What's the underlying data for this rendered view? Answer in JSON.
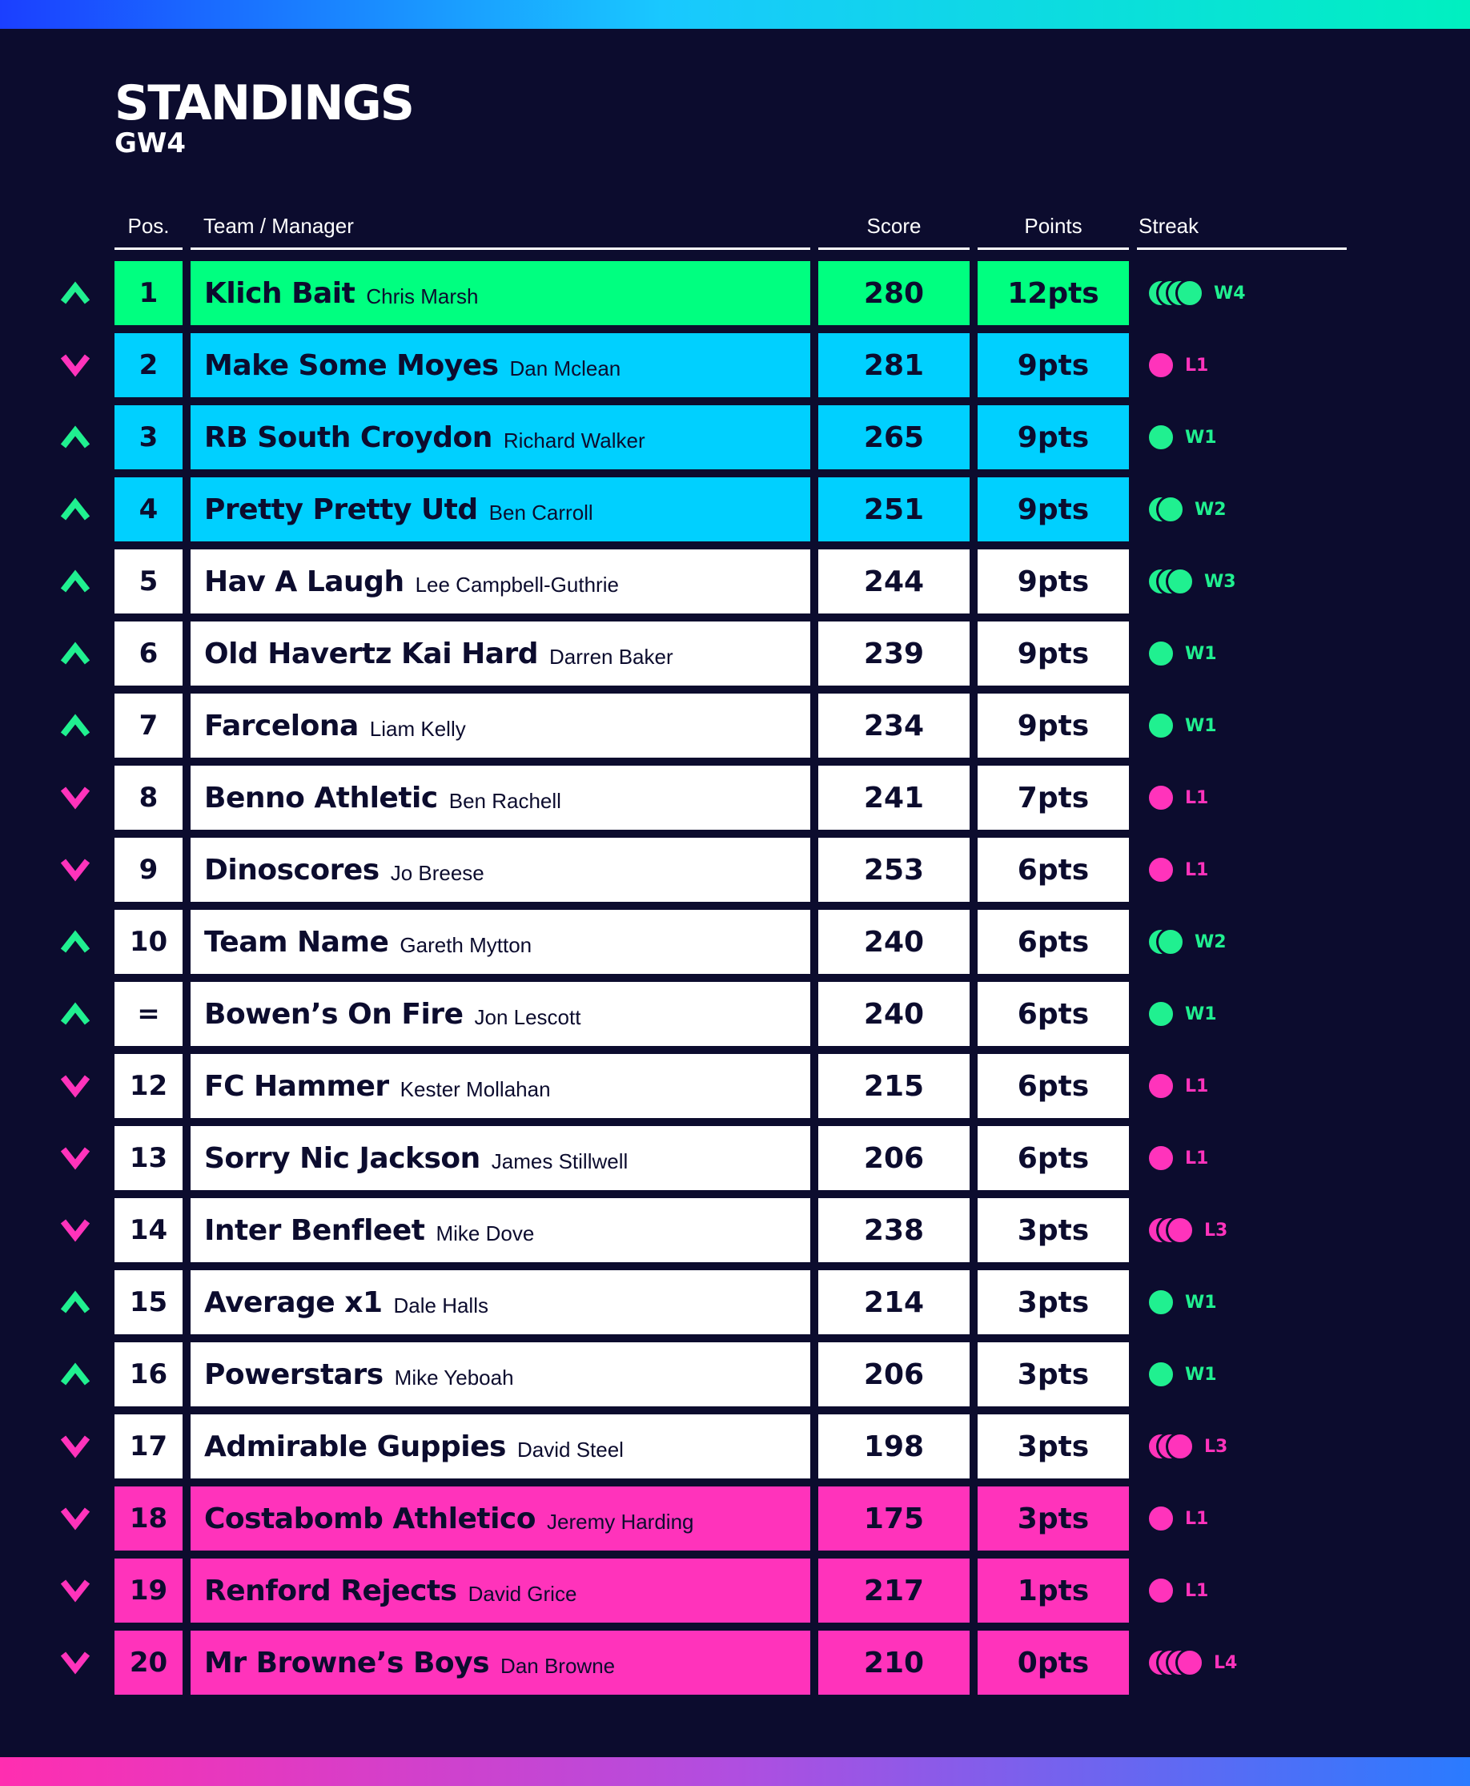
{
  "header": {
    "title": "STANDINGS",
    "subtitle": "GW4"
  },
  "columns": {
    "pos": "Pos.",
    "team": "Team / Manager",
    "score": "Score",
    "points": "Points",
    "streak": "Streak"
  },
  "colors": {
    "background": "#0c0c2e",
    "champion": "#00ff80",
    "qualify": "#00d0ff",
    "normal": "#ffffff",
    "relegation": "#ff33bb",
    "up": "#20f090",
    "down": "#ff33bb"
  },
  "rows": [
    {
      "pos": "1",
      "team": "Klich Bait",
      "manager": "Chris Marsh",
      "score": "280",
      "points": "12pts",
      "move": "up",
      "streak": "W4",
      "zone": "champion"
    },
    {
      "pos": "2",
      "team": "Make Some Moyes",
      "manager": "Dan Mclean",
      "score": "281",
      "points": "9pts",
      "move": "down",
      "streak": "L1",
      "zone": "qualify"
    },
    {
      "pos": "3",
      "team": "RB South Croydon",
      "manager": "Richard Walker",
      "score": "265",
      "points": "9pts",
      "move": "up",
      "streak": "W1",
      "zone": "qualify"
    },
    {
      "pos": "4",
      "team": "Pretty Pretty Utd",
      "manager": "Ben Carroll",
      "score": "251",
      "points": "9pts",
      "move": "up",
      "streak": "W2",
      "zone": "qualify"
    },
    {
      "pos": "5",
      "team": "Hav A Laugh",
      "manager": "Lee Campbell-Guthrie",
      "score": "244",
      "points": "9pts",
      "move": "up",
      "streak": "W3",
      "zone": "normal"
    },
    {
      "pos": "6",
      "team": "Old Havertz Kai Hard",
      "manager": "Darren Baker",
      "score": "239",
      "points": "9pts",
      "move": "up",
      "streak": "W1",
      "zone": "normal"
    },
    {
      "pos": "7",
      "team": "Farcelona",
      "manager": "Liam Kelly",
      "score": "234",
      "points": "9pts",
      "move": "up",
      "streak": "W1",
      "zone": "normal"
    },
    {
      "pos": "8",
      "team": "Benno Athletic",
      "manager": "Ben Rachell",
      "score": "241",
      "points": "7pts",
      "move": "down",
      "streak": "L1",
      "zone": "normal"
    },
    {
      "pos": "9",
      "team": "Dinoscores",
      "manager": "Jo Breese",
      "score": "253",
      "points": "6pts",
      "move": "down",
      "streak": "L1",
      "zone": "normal"
    },
    {
      "pos": "10",
      "team": "Team Name",
      "manager": "Gareth Mytton",
      "score": "240",
      "points": "6pts",
      "move": "up",
      "streak": "W2",
      "zone": "normal"
    },
    {
      "pos": "=",
      "team": "Bowen’s On Fire",
      "manager": "Jon Lescott",
      "score": "240",
      "points": "6pts",
      "move": "up",
      "streak": "W1",
      "zone": "normal"
    },
    {
      "pos": "12",
      "team": "FC Hammer",
      "manager": "Kester Mollahan",
      "score": "215",
      "points": "6pts",
      "move": "down",
      "streak": "L1",
      "zone": "normal"
    },
    {
      "pos": "13",
      "team": "Sorry Nic Jackson",
      "manager": "James Stillwell",
      "score": "206",
      "points": "6pts",
      "move": "down",
      "streak": "L1",
      "zone": "normal"
    },
    {
      "pos": "14",
      "team": "Inter Benfleet",
      "manager": "Mike Dove",
      "score": "238",
      "points": "3pts",
      "move": "down",
      "streak": "L3",
      "zone": "normal"
    },
    {
      "pos": "15",
      "team": "Average x1",
      "manager": "Dale Halls",
      "score": "214",
      "points": "3pts",
      "move": "up",
      "streak": "W1",
      "zone": "normal"
    },
    {
      "pos": "16",
      "team": "Powerstars",
      "manager": "Mike Yeboah",
      "score": "206",
      "points": "3pts",
      "move": "up",
      "streak": "W1",
      "zone": "normal"
    },
    {
      "pos": "17",
      "team": "Admirable Guppies",
      "manager": "David Steel",
      "score": "198",
      "points": "3pts",
      "move": "down",
      "streak": "L3",
      "zone": "normal"
    },
    {
      "pos": "18",
      "team": "Costabomb Athletico",
      "manager": "Jeremy Harding",
      "score": "175",
      "points": "3pts",
      "move": "down",
      "streak": "L1",
      "zone": "relegation"
    },
    {
      "pos": "19",
      "team": "Renford Rejects",
      "manager": "David Grice",
      "score": "217",
      "points": "1pts",
      "move": "down",
      "streak": "L1",
      "zone": "relegation"
    },
    {
      "pos": "20",
      "team": "Mr Browne’s Boys",
      "manager": "Dan Browne",
      "score": "210",
      "points": "0pts",
      "move": "down",
      "streak": "L4",
      "zone": "relegation"
    }
  ]
}
